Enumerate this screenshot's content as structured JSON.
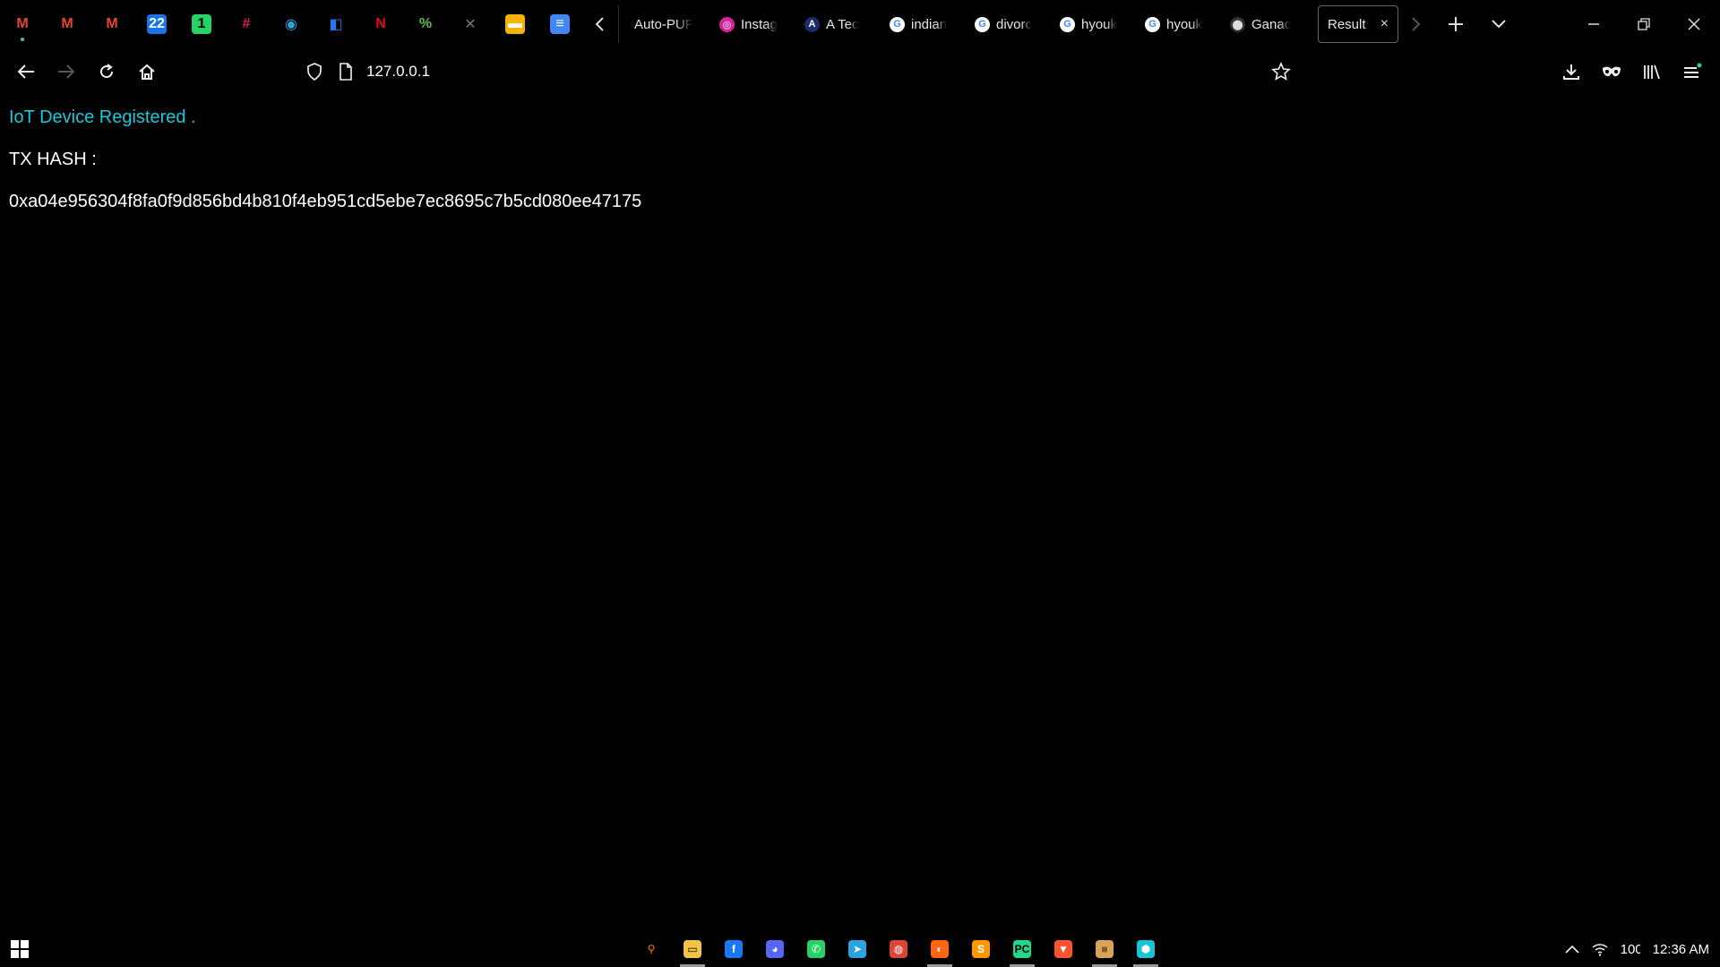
{
  "pinned_tabs": [
    {
      "name": "gmail-icon",
      "glyph": "M",
      "color": "#ea4335",
      "bg": "transparent",
      "dot": true
    },
    {
      "name": "gmail-icon",
      "glyph": "M",
      "color": "#ea4335",
      "bg": "transparent",
      "dot": false
    },
    {
      "name": "gmail-icon",
      "glyph": "M",
      "color": "#ea4335",
      "bg": "transparent",
      "dot": false
    },
    {
      "name": "calendar-icon",
      "glyph": "22",
      "color": "#ffffff",
      "bg": "#1a73e8",
      "dot": false
    },
    {
      "name": "whatsapp-icon",
      "glyph": "1",
      "color": "#000000",
      "bg": "#25d366",
      "dot": false
    },
    {
      "name": "slack-icon",
      "glyph": "#",
      "color": "#e01e5a",
      "bg": "transparent",
      "dot": false
    },
    {
      "name": "eye-icon",
      "glyph": "◉",
      "color": "#2fa0d8",
      "bg": "transparent",
      "dot": false
    },
    {
      "name": "bitwarden-icon",
      "glyph": "◧",
      "color": "#1d7af3",
      "bg": "transparent",
      "dot": false
    },
    {
      "name": "netflix-icon",
      "glyph": "N",
      "color": "#e50914",
      "bg": "transparent",
      "dot": false
    },
    {
      "name": "percent-icon",
      "glyph": "%",
      "color": "#5dbb4f",
      "bg": "transparent",
      "dot": false
    },
    {
      "name": "pen-icon",
      "glyph": "✕",
      "color": "#777777",
      "bg": "transparent",
      "dot": false
    },
    {
      "name": "slides-icon",
      "glyph": "▬",
      "color": "#ffffff",
      "bg": "#f4b400",
      "dot": false
    },
    {
      "name": "docs-icon",
      "glyph": "≡",
      "color": "#ffffff",
      "bg": "#4285f4",
      "dot": false
    }
  ],
  "tabs": [
    {
      "title": "Auto-PUF",
      "favicon": "",
      "fav_color": "transparent",
      "fav_text": "#fff"
    },
    {
      "title": "Instag",
      "favicon": "◎",
      "fav_color": "#d6249f",
      "fav_text": "#fff"
    },
    {
      "title": "A Tec",
      "favicon": "A",
      "fav_color": "#1f2a6b",
      "fav_text": "#fff"
    },
    {
      "title": "indian",
      "favicon": "G",
      "fav_color": "#ffffff",
      "fav_text": "#4285f4"
    },
    {
      "title": "divorc",
      "favicon": "G",
      "fav_color": "#ffffff",
      "fav_text": "#4285f4"
    },
    {
      "title": "hyouk",
      "favicon": "G",
      "fav_color": "#ffffff",
      "fav_text": "#4285f4"
    },
    {
      "title": "hyouk",
      "favicon": "G",
      "fav_color": "#ffffff",
      "fav_text": "#4285f4"
    },
    {
      "title": "Ganac",
      "favicon": "⬤",
      "fav_color": "#333333",
      "fav_text": "#ddd"
    }
  ],
  "active_tab": {
    "title": "Result",
    "close": "×"
  },
  "address": {
    "url": "127.0.0.1"
  },
  "page": {
    "status": "IoT Device Registered .",
    "tx_label": "TX HASH :",
    "tx_hash": "0xa04e956304f8fa0f9d856bd4b810f4eb951cd5ebe7ec8695c7b5cd080ee47175"
  },
  "taskbar": {
    "apps": [
      {
        "name": "search-app-icon",
        "glyph": "⚲",
        "color": "#ff7a00",
        "bg": "transparent",
        "running": false
      },
      {
        "name": "file-explorer-icon",
        "glyph": "▭",
        "color": "#000",
        "bg": "#f6c443",
        "running": true
      },
      {
        "name": "facebook-icon",
        "glyph": "f",
        "color": "#fff",
        "bg": "#1877f2",
        "running": false
      },
      {
        "name": "discord-icon",
        "glyph": "◕",
        "color": "#fff",
        "bg": "#5865f2",
        "running": false
      },
      {
        "name": "whatsapp-icon",
        "glyph": "✆",
        "color": "#fff",
        "bg": "#25d366",
        "running": false
      },
      {
        "name": "telegram-icon",
        "glyph": "➤",
        "color": "#fff",
        "bg": "#2aa3df",
        "running": false
      },
      {
        "name": "chrome-icon",
        "glyph": "◍",
        "color": "#fff",
        "bg": "#db4437",
        "running": false
      },
      {
        "name": "firefox-icon",
        "glyph": "◐",
        "color": "#fff",
        "bg": "#ff6611",
        "running": true
      },
      {
        "name": "sublime-icon",
        "glyph": "S",
        "color": "#fff",
        "bg": "#ff9800",
        "running": false
      },
      {
        "name": "pycharm-icon",
        "glyph": "PC",
        "color": "#000",
        "bg": "#21d789",
        "running": true
      },
      {
        "name": "brave-icon",
        "glyph": "▼",
        "color": "#fff",
        "bg": "#fb542b",
        "running": false
      },
      {
        "name": "package-icon",
        "glyph": "■",
        "color": "#8a5a2b",
        "bg": "#d9a35a",
        "running": true
      },
      {
        "name": "cube-icon",
        "glyph": "⬢",
        "color": "#fff",
        "bg": "#19c4d8",
        "running": true
      }
    ],
    "battery": "100",
    "clock": "12:36 AM"
  }
}
